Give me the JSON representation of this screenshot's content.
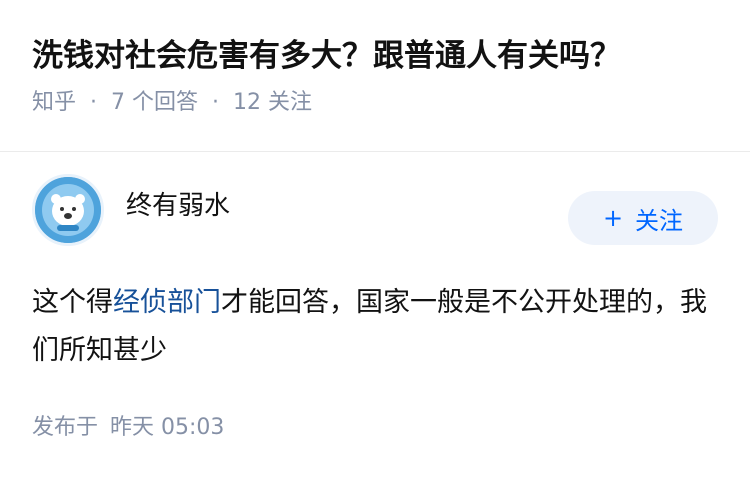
{
  "question": {
    "title": "洗钱对社会危害有多大？跟普通人有关吗？",
    "source": "知乎",
    "answer_count": "7 个回答",
    "follower_count": "12 关注"
  },
  "answer": {
    "author": "终有弱水",
    "follow_label": "关注",
    "content_before": "这个得",
    "content_link": "经侦部门",
    "content_after": "才能回答，国家一般是不公开处理的，我们所知甚少",
    "posted_label": "发布于",
    "posted_time": "昨天 05:03"
  },
  "colors": {
    "accent": "#0066ff",
    "link": "#175199",
    "meta": "#8590a6"
  }
}
